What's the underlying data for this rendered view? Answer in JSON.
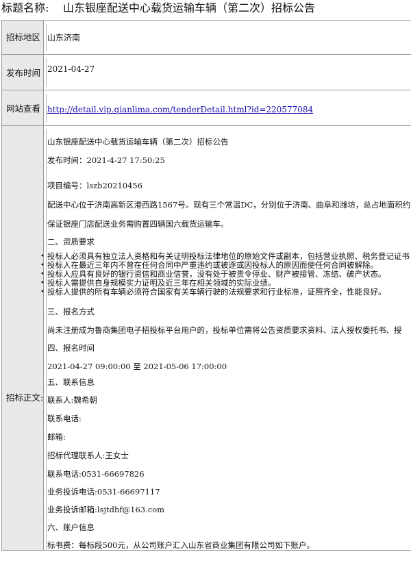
{
  "title": {
    "label": "标题名称:",
    "value": "山东银座配送中心载货运输车辆（第二次）招标公告"
  },
  "rows": {
    "region": {
      "label": "招标地区",
      "value": "山东济南"
    },
    "published": {
      "label": "发布时间",
      "value": "2021-04-27"
    },
    "web": {
      "label": "网站查看",
      "url": "http://detail.vip.qianlima.com/tenderDetail.html?id=220577084"
    },
    "body": {
      "label": "招标正文:"
    }
  },
  "content": {
    "heading": "山东银座配送中心载货运输车辆（第二次）招标公告",
    "publish_time": "发布时间：2021-4-27 17:50:25",
    "project_no": "项目编号：lszb20210456",
    "intro_1": "配送中心位于济南高新区港西路1567号。现有三个常温DC，分别位于济南、曲阜和潍坊，总占地面积约6",
    "intro_2": "保证银座门店配送业务需购置四辆国六载货运输车。",
    "sec2": "二、资质要求",
    "qualifications": [
      "投标人必须具有独立法人资格和有关证明投标法律地位的原始文件或副本，包括营业执照、税务登记证书",
      "投标人在最近三年内不曾在任何合同中严重违约或被逐或因投标人的原因而使任何合同被解除。",
      "投标人应具有良好的银行资信和商业信誉，没有处于被责令停业、财产被接管、冻结、破产状态。",
      "投标人需提供自身规模实力证明及近三年在相关领域的实际业绩。",
      "投标人提供的所有车辆必须符合国家有关车辆行驶的法规要求和行业标准，证照齐全，性能良好。"
    ],
    "sec3": "三、报名方式",
    "sec3_text": "尚未注册成为鲁商集团电子招投标平台用户的，投标单位需将公告资质要求资料、法人授权委托书、授",
    "sec4": "四、报名时间",
    "sec4_text": "2021-04-27 09:00:00 至 2021-05-06 17:00:00",
    "sec5": "五、联系信息",
    "contact": "联系人:魏希朝",
    "phone": "联系电话:",
    "email": "邮箱:",
    "agent_contact": "招标代理联系人:王女士",
    "agent_phone": "联系电话:0531-66697826",
    "complaint_phone": "业务投诉电话:0531-66697117",
    "complaint_email": "业务投诉邮箱:lsjtdhf@163.com",
    "sec6": "六、账户信息",
    "fee": "标书费：每标段500元，从公司账户汇入山东省商业集团有限公司如下账户。"
  }
}
